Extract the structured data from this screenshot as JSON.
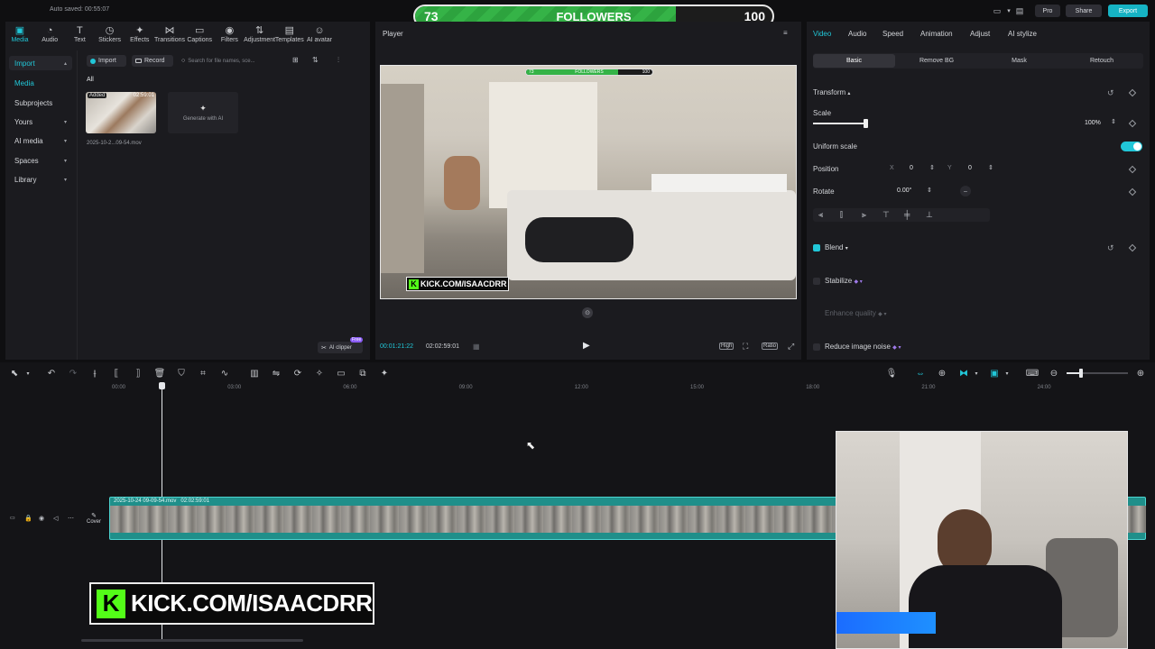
{
  "status": {
    "autosave": "Auto saved: 00:55:07"
  },
  "top_tabs": [
    {
      "label": "Media",
      "icon": "media-icon",
      "glyph": "▣"
    },
    {
      "label": "Audio",
      "icon": "audio-icon",
      "glyph": "◔"
    },
    {
      "label": "Text",
      "icon": "text-icon",
      "glyph": "T"
    },
    {
      "label": "Stickers",
      "icon": "stickers-icon",
      "glyph": "◷"
    },
    {
      "label": "Effects",
      "icon": "effects-icon",
      "glyph": "✦"
    },
    {
      "label": "Transitions",
      "icon": "transitions-icon",
      "glyph": "⋈"
    },
    {
      "label": "Captions",
      "icon": "captions-icon",
      "glyph": "▭"
    },
    {
      "label": "Filters",
      "icon": "filters-icon",
      "glyph": "◉"
    },
    {
      "label": "Adjustment",
      "icon": "adjustment-icon",
      "glyph": "⇅"
    },
    {
      "label": "Templates",
      "icon": "templates-icon",
      "glyph": "▤"
    },
    {
      "label": "AI avatar",
      "icon": "ai-avatar-icon",
      "glyph": "☺"
    }
  ],
  "sidebar": {
    "items": [
      {
        "label": "Import",
        "chevron": "▴"
      },
      {
        "label": "Media",
        "chevron": ""
      },
      {
        "label": "Subprojects",
        "chevron": ""
      },
      {
        "label": "Yours",
        "chevron": "▾"
      },
      {
        "label": "AI media",
        "chevron": "▾"
      },
      {
        "label": "Spaces",
        "chevron": "▾"
      },
      {
        "label": "Library",
        "chevron": "▾"
      }
    ]
  },
  "media_panel": {
    "import_label": "Import",
    "record_label": "Record",
    "search_placeholder": "Search for file names, sce...",
    "filter_all": "All",
    "clip": {
      "badge": "Added",
      "duration": "02:59:01",
      "filename": "2025-10-2...09-54.mov"
    },
    "generate_label": "Generate with AI",
    "ai_clipper": {
      "label": "AI clipper",
      "badge": "Free"
    }
  },
  "overlay": {
    "followers_current": "73",
    "followers_label": "FOLLOWERS",
    "followers_goal": "100",
    "followers_progress": 0.73
  },
  "player": {
    "title": "Player",
    "current_time": "00:01:21:22",
    "total_time": "02:02:59:01",
    "quality": "High",
    "ratio": "Ratio",
    "kick_banner": "KICK.COM/ISAACDRR",
    "kick_mini_current": "73",
    "kick_mini_goal": "100"
  },
  "right_tabs": [
    "Video",
    "Audio",
    "Speed",
    "Animation",
    "Adjust",
    "AI stylize"
  ],
  "sub_tabs": [
    "Basic",
    "Remove BG",
    "Mask",
    "Retouch"
  ],
  "props": {
    "transform": "Transform",
    "scale": "Scale",
    "scale_value": "100%",
    "scale_level": 1.0,
    "uniform_scale": "Uniform scale",
    "position": "Position",
    "pos_x_label": "X",
    "pos_x": "0",
    "pos_y_label": "Y",
    "pos_y": "0",
    "rotate": "Rotate",
    "rotate_value": "0.00°",
    "blend": "Blend",
    "stabilize": "Stabilize",
    "enhance_quality": "Enhance quality",
    "reduce_noise": "Reduce image noise"
  },
  "header_buttons": {
    "pro": "Pro",
    "share": "Share",
    "export": "Export"
  },
  "timeline": {
    "ruler": [
      "00:00",
      "03:00",
      "06:00",
      "09:00",
      "12:00",
      "15:00",
      "18:00",
      "21:00",
      "24:00"
    ],
    "clip_label": "2025-10-24 09-09-54.mov   02:02:59:01",
    "cover_label": "Cover"
  },
  "bottom_banner": {
    "text": "KICK.COM/ISAACDRR"
  },
  "colors": {
    "accent": "#21c7d8",
    "brand_green": "#53fc18",
    "track": "#1f8f8a"
  }
}
